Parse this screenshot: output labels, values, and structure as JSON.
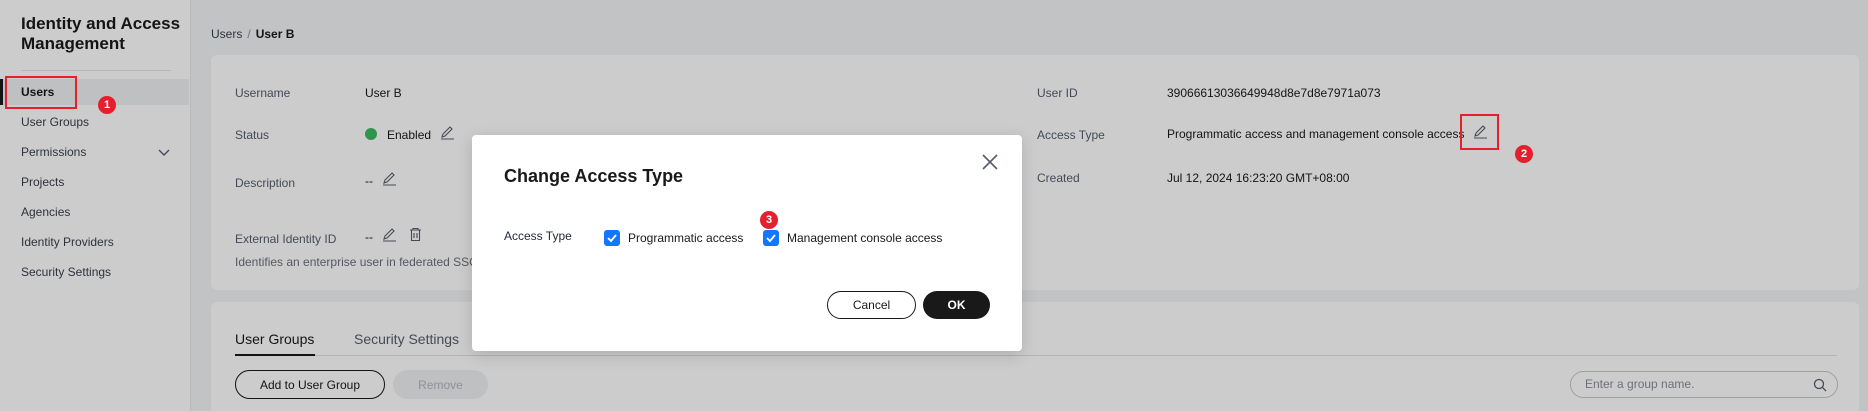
{
  "sidebar": {
    "title": "Identity and Access Management",
    "items": [
      {
        "label": "Users"
      },
      {
        "label": "User Groups"
      },
      {
        "label": "Permissions"
      },
      {
        "label": "Projects"
      },
      {
        "label": "Agencies"
      },
      {
        "label": "Identity Providers"
      },
      {
        "label": "Security Settings"
      }
    ]
  },
  "breadcrumb": {
    "parent": "Users",
    "separator": "/",
    "current": "User B"
  },
  "details": {
    "username_label": "Username",
    "username_value": "User B",
    "status_label": "Status",
    "status_value": "Enabled",
    "description_label": "Description",
    "description_value": "--",
    "external_id_label": "External Identity ID",
    "external_id_value": "--",
    "external_id_hint": "Identifies an enterprise user in federated SSO",
    "user_id_label": "User ID",
    "user_id_value": "39066613036649948d8e7d8e7971a073",
    "access_type_label": "Access Type",
    "access_type_value": "Programmatic access and management console access",
    "created_label": "Created",
    "created_value": "Jul 12, 2024 16:23:20 GMT+08:00"
  },
  "tabs": [
    {
      "label": "User Groups"
    },
    {
      "label": "Security Settings"
    }
  ],
  "toolbar": {
    "add_label": "Add to User Group",
    "remove_label": "Remove"
  },
  "search": {
    "placeholder": "Enter a group name."
  },
  "modal": {
    "title": "Change Access Type",
    "field_label": "Access Type",
    "option_programmatic": "Programmatic access",
    "option_console": "Management console access",
    "cancel_label": "Cancel",
    "ok_label": "OK"
  },
  "annotations": {
    "step1": "1",
    "step2": "2",
    "step3": "3"
  },
  "colors": {
    "accent": "#1476ff",
    "highlight": "#e5202e",
    "primary_button": "#191919",
    "status_enabled": "#3dba61"
  }
}
